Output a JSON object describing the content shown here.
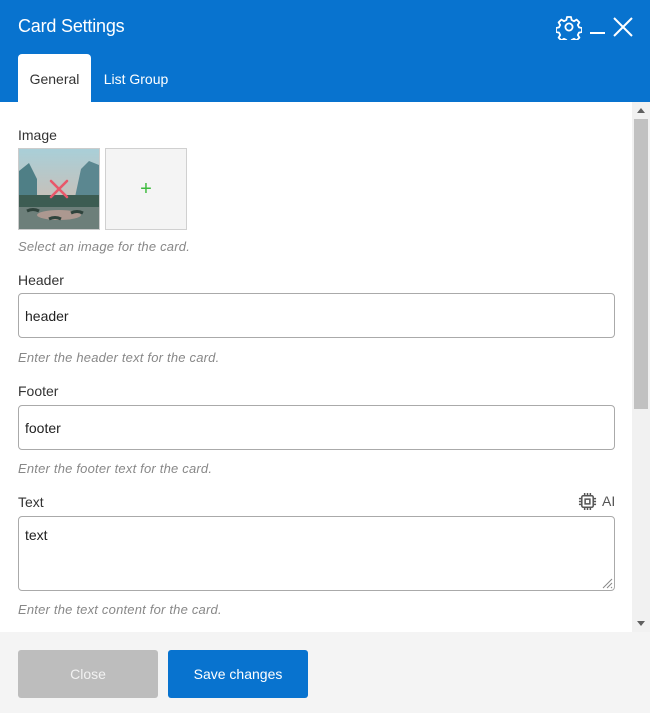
{
  "dialog": {
    "title": "Card Settings"
  },
  "icons": {
    "settings": "gear-icon",
    "minimize": "minimize-icon",
    "close": "close-icon",
    "ai": "chip-icon"
  },
  "tabs": [
    {
      "label": "General",
      "active": true
    },
    {
      "label": "List Group",
      "active": false
    }
  ],
  "image_field": {
    "label": "Image",
    "hint": "Select an image for the card.",
    "add_symbol": "+"
  },
  "header_field": {
    "label": "Header",
    "value": "header",
    "hint": "Enter the header text for the card."
  },
  "footer_field": {
    "label": "Footer",
    "value": "footer",
    "hint": "Enter the footer text for the card."
  },
  "text_field": {
    "label": "Text",
    "value": "text",
    "hint": "Enter the text content for the card.",
    "ai_label": "AI"
  },
  "footer_buttons": {
    "close_label": "Close",
    "save_label": "Save changes"
  },
  "colors": {
    "accent": "#0873cf",
    "remove_mark": "#e8586a",
    "add_plus": "#3dbb3d",
    "close_button": "#bdbdbd"
  }
}
